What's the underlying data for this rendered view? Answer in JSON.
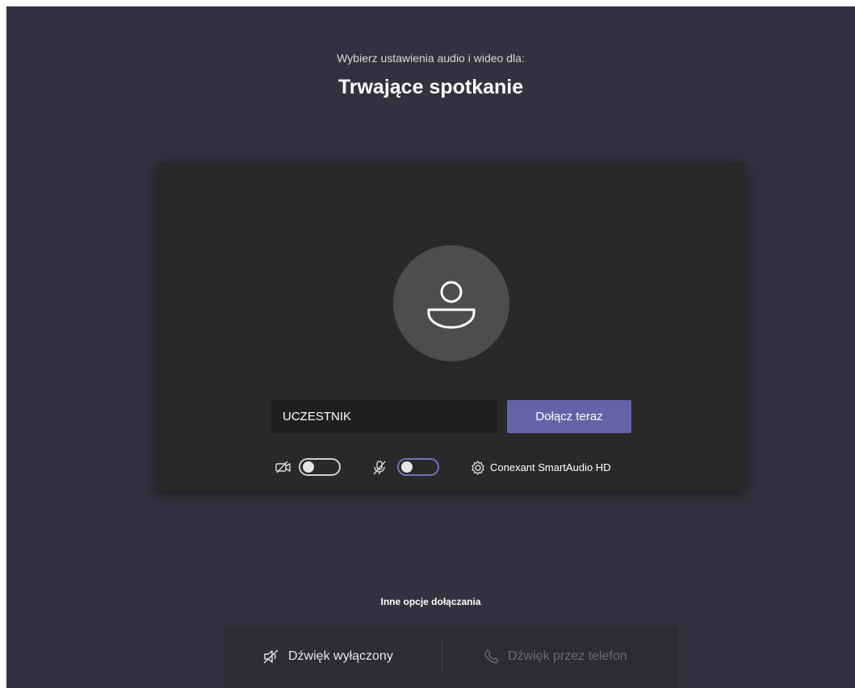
{
  "header": {
    "subtitle": "Wybierz ustawienia audio i wideo dla:",
    "title": "Trwające spotkanie"
  },
  "preview": {
    "avatar_icon": "person-icon",
    "name_value": "UCZESTNIK",
    "join_label": "Dołącz teraz"
  },
  "controls": {
    "camera_icon": "camera-off-icon",
    "camera_on": false,
    "mic_icon": "mic-off-icon",
    "mic_on": false,
    "settings_icon": "gear-icon",
    "device_label": "Conexant SmartAudio HD"
  },
  "other_options": {
    "heading": "Inne opcje dołączania",
    "audio_off_label": "Dźwięk wyłączony",
    "audio_off_icon": "speaker-off-icon",
    "phone_label": "Dźwięk przez telefon",
    "phone_icon": "phone-icon"
  },
  "colors": {
    "background": "#33313f",
    "panel": "#292929",
    "accent": "#6264a7"
  }
}
